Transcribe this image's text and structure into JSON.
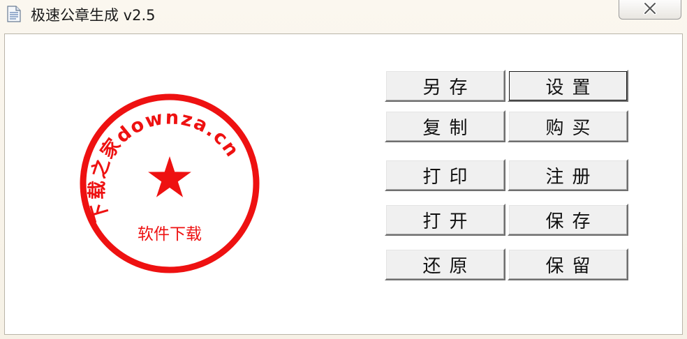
{
  "window": {
    "title": "极速公章生成 v2.5",
    "close_icon": "close-icon"
  },
  "seal": {
    "arc_text": "下载之家downza.cn",
    "bottom_text": "软件下载",
    "center_icon": "star-icon",
    "color": "#ee1111"
  },
  "buttons": [
    {
      "label": "另存",
      "name": "save-as-button"
    },
    {
      "label": "设置",
      "name": "settings-button"
    },
    {
      "label": "复制",
      "name": "copy-button"
    },
    {
      "label": "购买",
      "name": "buy-button"
    },
    {
      "label": "打印",
      "name": "print-button"
    },
    {
      "label": "注册",
      "name": "register-button"
    },
    {
      "label": "打开",
      "name": "open-button"
    },
    {
      "label": "保存",
      "name": "save-button"
    },
    {
      "label": "还原",
      "name": "restore-button"
    },
    {
      "label": "保留",
      "name": "keep-button"
    }
  ]
}
